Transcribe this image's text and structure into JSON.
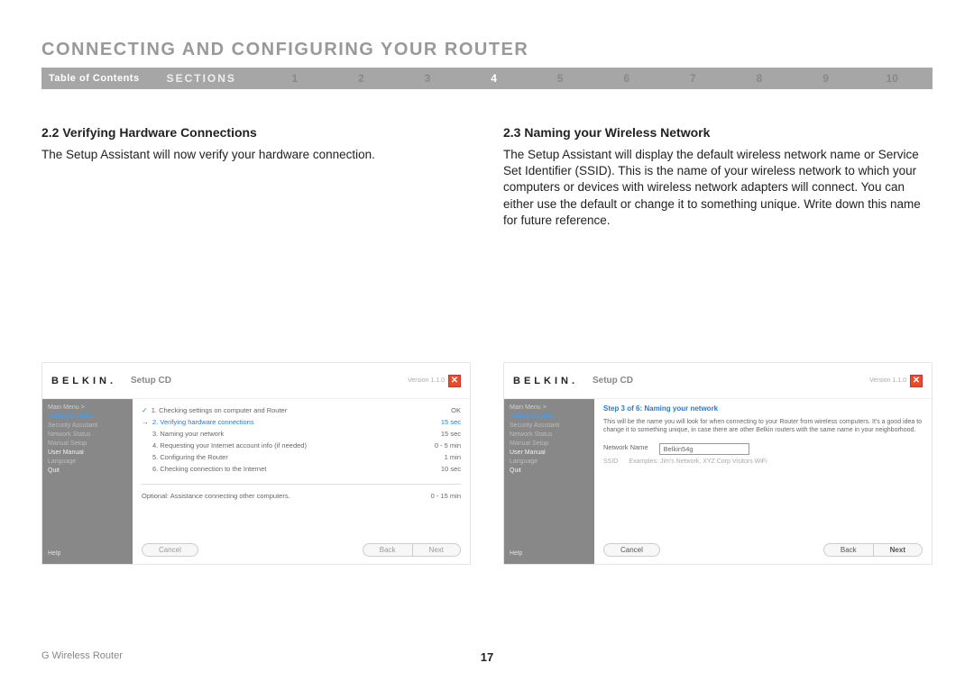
{
  "page_title": "CONNECTING AND CONFIGURING YOUR ROUTER",
  "nav": {
    "toc": "Table of Contents",
    "sections_label": "SECTIONS",
    "items": [
      "1",
      "2",
      "3",
      "4",
      "5",
      "6",
      "7",
      "8",
      "9",
      "10"
    ],
    "active_index": 3
  },
  "col_left": {
    "heading": "2.2 Verifying Hardware Connections",
    "body": "The Setup Assistant will now verify your hardware connection."
  },
  "col_right": {
    "heading": "2.3 Naming your Wireless Network",
    "body": "The Setup Assistant will display the default wireless network name or Service Set Identifier (SSID). This is the name of your wireless network to which your computers or devices with wireless network adapters will connect. You can either use the default or change it to something unique. Write down this name for future reference."
  },
  "shot1": {
    "brand": "BELKIN.",
    "app_title": "Setup CD",
    "version": "Version 1.1.0",
    "close_glyph": "✕",
    "sidebar": {
      "main_menu": "Main Menu  >",
      "setup_assistant": "Setup Assistant",
      "security_assistant": "Security Assistant",
      "network_status": "Network Status",
      "manual_setup": "Manual Setup",
      "user_manual": "User Manual",
      "language": "Language",
      "quit": "Quit",
      "help": "Help"
    },
    "steps": [
      {
        "icon": "check",
        "num": "1.",
        "label": "Checking settings on computer and Router",
        "est": "OK"
      },
      {
        "icon": "arrow",
        "num": "2.",
        "label": "Verifying hardware connections",
        "est": "15 sec"
      },
      {
        "icon": "",
        "num": "3.",
        "label": "Naming your network",
        "est": "15 sec"
      },
      {
        "icon": "",
        "num": "4.",
        "label": "Requesting your Internet account info (if needed)",
        "est": "0 - 5 min"
      },
      {
        "icon": "",
        "num": "5.",
        "label": "Configuring the Router",
        "est": "1 min"
      },
      {
        "icon": "",
        "num": "6.",
        "label": "Checking connection to the Internet",
        "est": "10 sec"
      }
    ],
    "optional": {
      "label": "Optional: Assistance connecting other computers.",
      "est": "0 - 15 min"
    },
    "buttons": {
      "cancel": "Cancel",
      "back": "Back",
      "next": "Next"
    }
  },
  "shot2": {
    "brand": "BELKIN.",
    "app_title": "Setup CD",
    "version": "Version 1.1.0",
    "close_glyph": "✕",
    "sidebar": {
      "main_menu": "Main Menu  >",
      "setup_assistant": "Setup Assistant",
      "security_assistant": "Security Assistant",
      "network_status": "Network Status",
      "manual_setup": "Manual Setup",
      "user_manual": "User Manual",
      "language": "Language",
      "quit": "Quit",
      "help": "Help"
    },
    "step_head": "Step 3 of 6: Naming your network",
    "desc": "This will be the name you will look for when connecting to your Router from wireless computers. It's a good idea to change it to something unique, in case there are other Belkin routers with the same name in your neighborhood.",
    "network_name_label": "Network Name",
    "network_name_value": "Belkin54g",
    "ssid_label": "SSID",
    "ssid_examples": "Examples: Jim's Network, XYZ Corp Visitors WiFi",
    "buttons": {
      "cancel": "Cancel",
      "back": "Back",
      "next": "Next"
    }
  },
  "footer": {
    "product": "G Wireless Router",
    "page": "17"
  }
}
